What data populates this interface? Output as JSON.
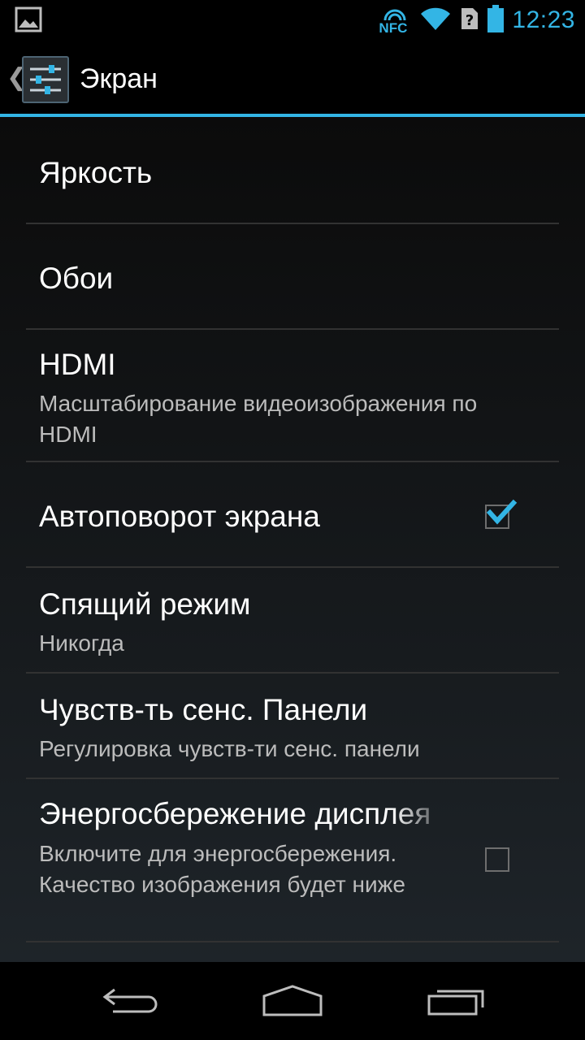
{
  "status_bar": {
    "time": "12:23",
    "nfc_label": "NFC",
    "icons": [
      "gallery-icon",
      "nfc-icon",
      "wifi-icon",
      "no-sim-icon",
      "battery-icon"
    ],
    "accent_color": "#33b5e5"
  },
  "action_bar": {
    "title": "Экран",
    "icon": "settings-sliders-icon"
  },
  "preferences": [
    {
      "title": "Яркость"
    },
    {
      "title": "Обои"
    },
    {
      "title": "HDMI",
      "summary": "Масштабирование видеоизображения по HDMI"
    },
    {
      "title": "Автоповорот экрана",
      "checked": true
    },
    {
      "title": "Спящий режим",
      "summary": "Никогда"
    },
    {
      "title": "Чувств-ть сенс. Панели",
      "summary": "Регулировка чувств-ти сенс. панели"
    },
    {
      "title": "Энергосбережение дисплея",
      "summary": "Включите для энергосбережения. Качество изображения будет ниже",
      "checked": false
    }
  ],
  "nav_bar": {
    "icons": [
      "back-icon",
      "home-icon",
      "recent-apps-icon"
    ]
  }
}
